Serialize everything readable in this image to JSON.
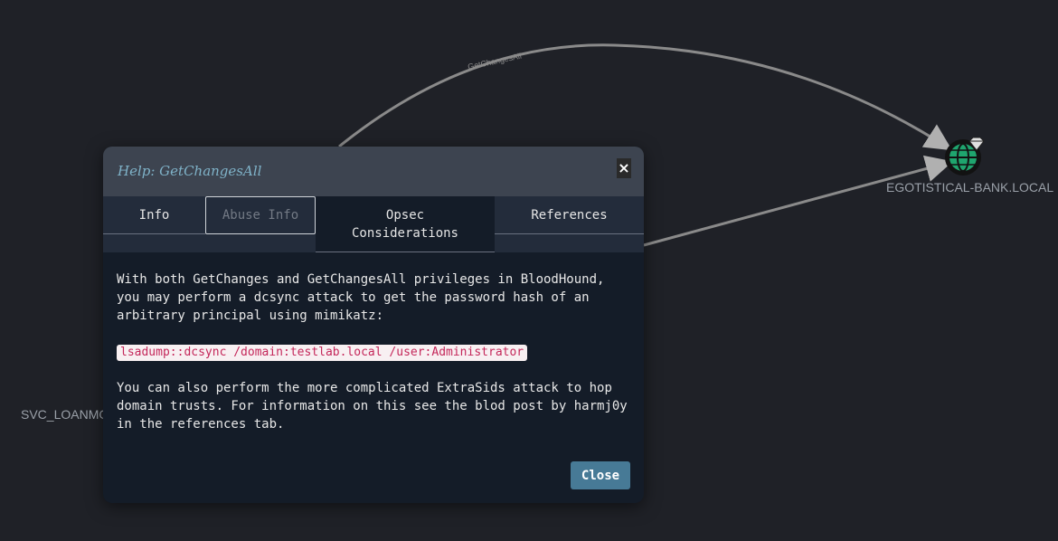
{
  "graph": {
    "edge_label": "GetChangesAll",
    "left_node_label": "SVC_LOANMGR",
    "right_node_label": "EGOTISTICAL-BANK.LOCAL"
  },
  "modal": {
    "title": "Help: GetChangesAll",
    "close_x": "×",
    "tabs": {
      "info": "Info",
      "abuse": "Abuse Info",
      "opsec_line1": "Opsec",
      "opsec_line2": "Considerations",
      "references": "References"
    },
    "body": {
      "paragraph1": "With both GetChanges and GetChangesAll privileges in BloodHound, you may perform a dcsync attack to get the password hash of an arbitrary principal using mimikatz:",
      "code": "lsadump::dcsync /domain:testlab.local /user:Administrator",
      "paragraph2": "You can also perform the more complicated ExtraSids attack to hop domain trusts. For information on this see the blod post by harmj0y in the references tab."
    },
    "close_button": "Close"
  }
}
